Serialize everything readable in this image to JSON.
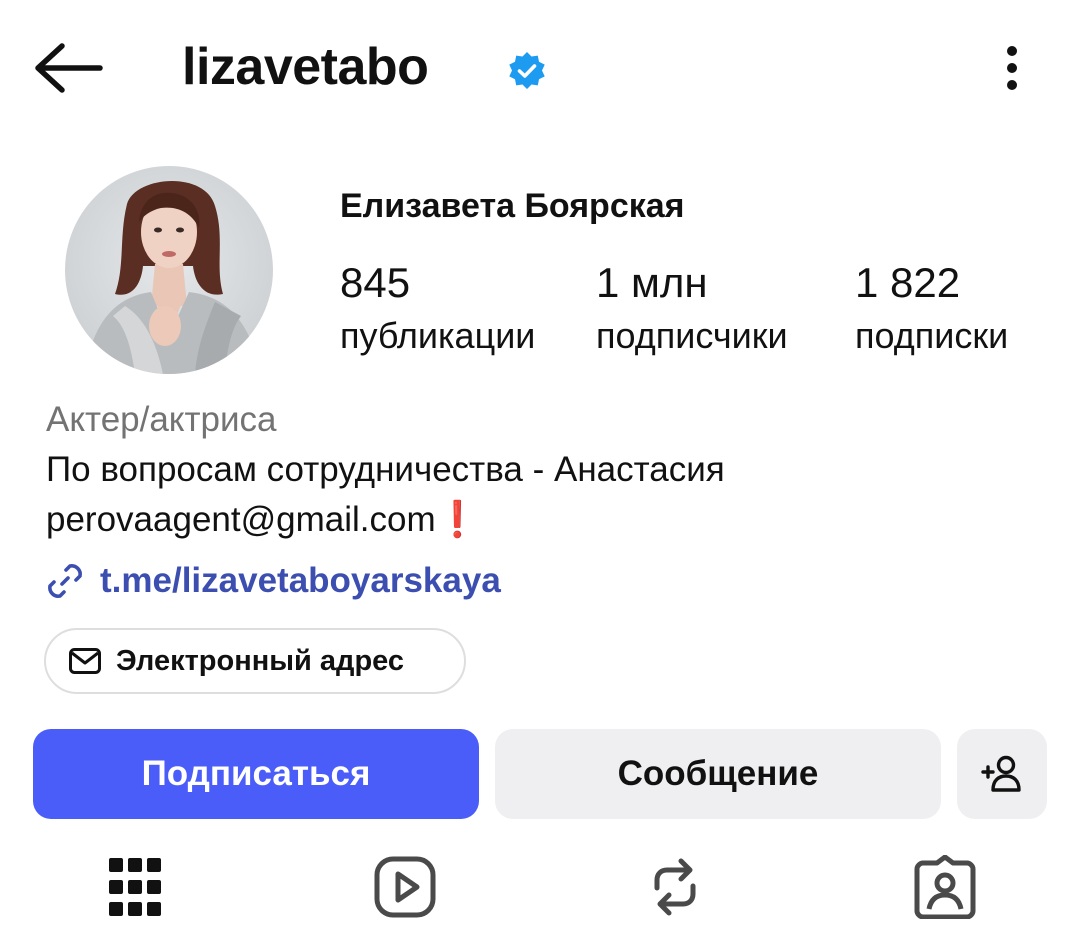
{
  "header": {
    "username": "lizavetabo",
    "verified_color": "#1d9bf0",
    "icons": {
      "back": "arrow-left-icon",
      "verified": "verified-badge-icon",
      "more": "more-vertical-icon"
    }
  },
  "profile": {
    "full_name": "Елизавета Боярская",
    "stats": [
      {
        "value": "845",
        "label": "публикации"
      },
      {
        "value": "1 млн",
        "label": "подписчики"
      },
      {
        "value": "1 822",
        "label": "подписки"
      }
    ],
    "category": "Актер/актриса",
    "bio_line1": "По вопросам сотрудничества - Анастасия",
    "bio_line2": "perovaagent@gmail.com",
    "bio_line2_emoji": "❗",
    "link": "t.me/lizavetaboyarskaya",
    "email_chip_label": "Электронный адрес"
  },
  "actions": {
    "follow_label": "Подписаться",
    "message_label": "Сообщение",
    "accent_color": "#4a5df9"
  },
  "tabs": [
    {
      "name": "posts",
      "icon": "grid-icon"
    },
    {
      "name": "reels",
      "icon": "reels-play-icon"
    },
    {
      "name": "reposts",
      "icon": "repost-icon"
    },
    {
      "name": "tagged",
      "icon": "tagged-person-icon"
    }
  ]
}
